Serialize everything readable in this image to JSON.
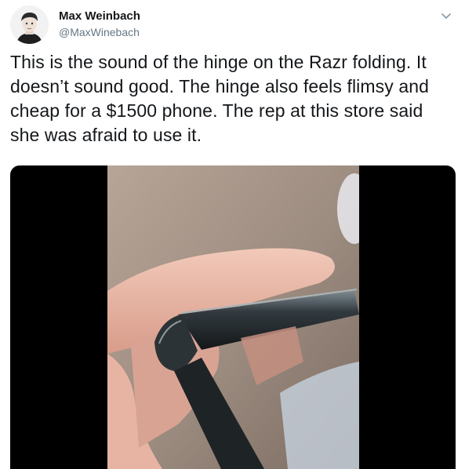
{
  "tweet": {
    "author_name": "Max Weinbach",
    "author_handle": "@MaxWinebach",
    "text": "This is the sound of the hinge on the Razr folding. It doesn’t sound good. The hinge also feels flimsy and cheap for a $1500 phone. The rep at this store said she was afraid to use it."
  },
  "icons": {
    "caret": "chevron-down-icon",
    "avatar": "avatar"
  },
  "colors": {
    "name": "#14171a",
    "handle": "#657786",
    "media_background": "#000000"
  }
}
